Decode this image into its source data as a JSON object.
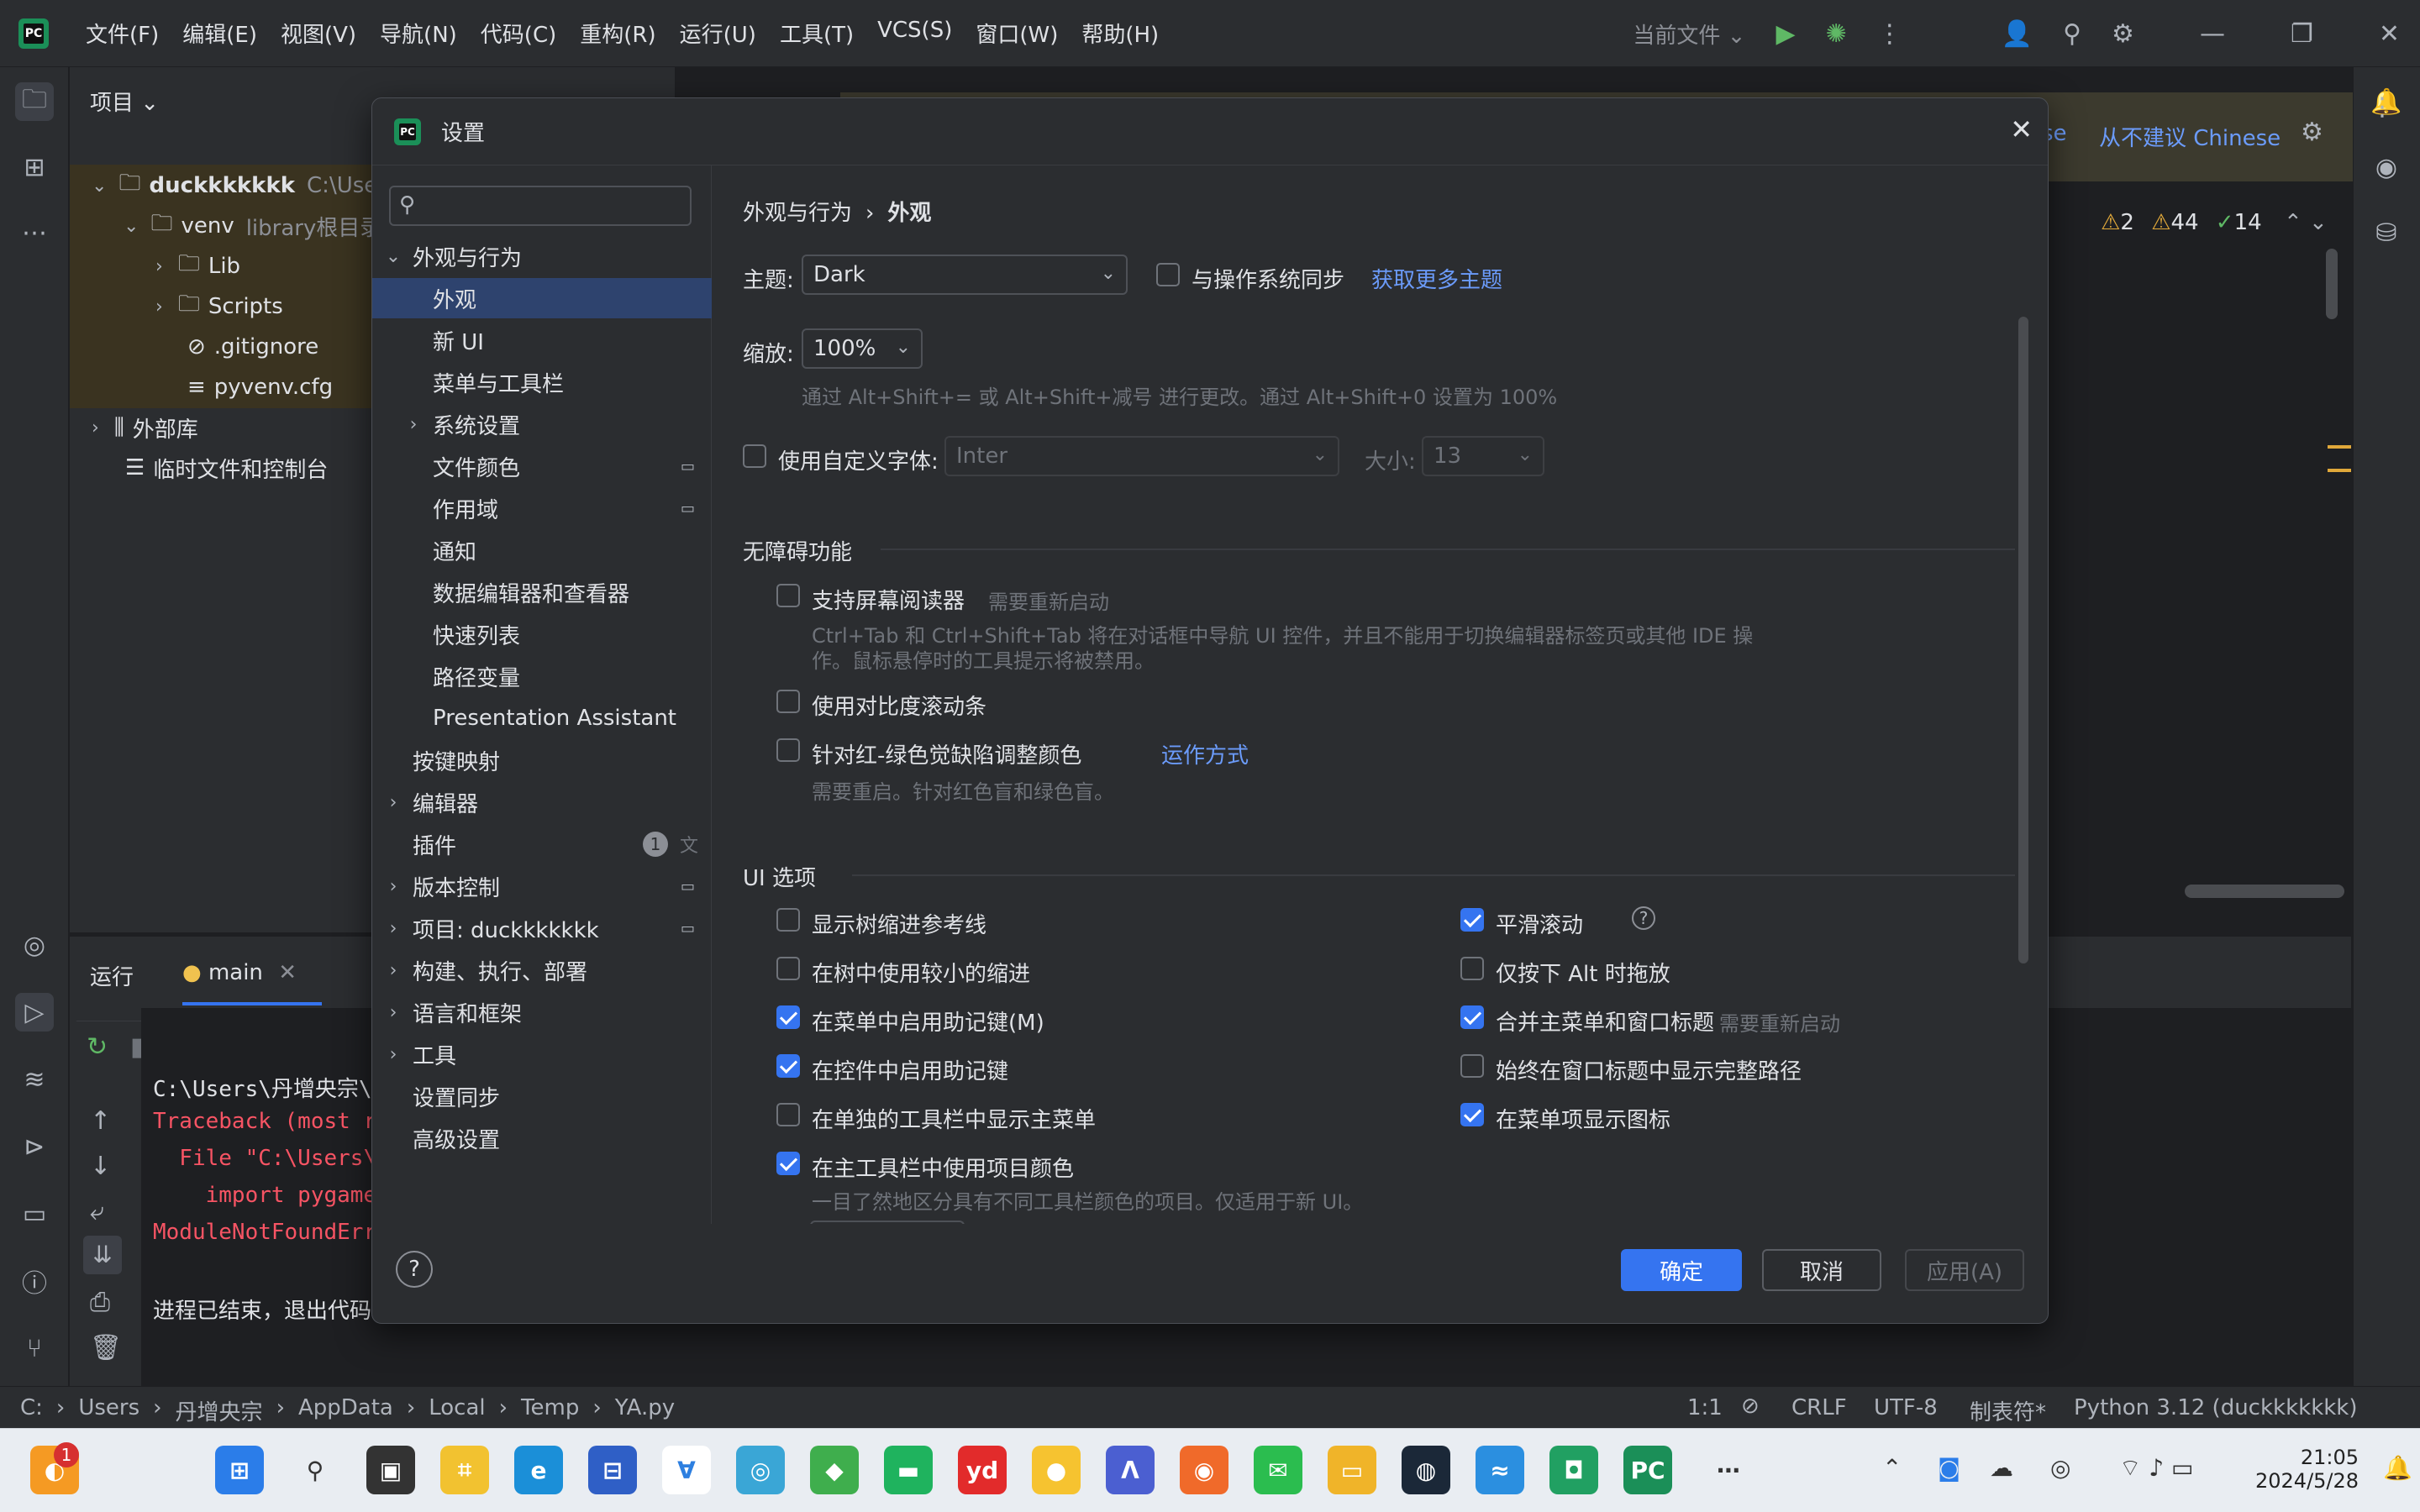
{
  "titlebar": {
    "menus": [
      "文件(F)",
      "编辑(E)",
      "视图(V)",
      "导航(N)",
      "代码(C)",
      "重构(R)",
      "运行(U)",
      "工具(T)",
      "VCS(S)",
      "窗口(W)",
      "帮助(H)"
    ],
    "run_config": "当前文件",
    "logo_text": "PC"
  },
  "project": {
    "title": "项目",
    "rows": [
      {
        "label": "duckkkkkkk",
        "extra": "C:\\Users",
        "bold": true
      },
      {
        "label": "venv",
        "extra": "library根目录"
      },
      {
        "label": "Lib"
      },
      {
        "label": "Scripts"
      },
      {
        "label": ".gitignore"
      },
      {
        "label": "pyvenv.cfg"
      },
      {
        "label": "外部库"
      },
      {
        "label": "临时文件和控制台"
      }
    ]
  },
  "editor": {
    "banner_link": "从不建议 Chinese",
    "banner_partial": "se",
    "inspections": {
      "warn_a": "2",
      "warn_b": "44",
      "ok": "14"
    }
  },
  "run": {
    "tab_label": "运行",
    "tab_name": "main",
    "lines": [
      "C:\\Users\\丹增央宗\\",
      "Traceback (most r",
      "  File \"C:\\Users\\",
      "    import pygame",
      "ModuleNotFoundErr",
      "",
      "进程已结束，退出代码"
    ]
  },
  "status": {
    "path": [
      "C:",
      "Users",
      "丹增央宗",
      "AppData",
      "Local",
      "Temp",
      "YA.py"
    ],
    "position": "1:1",
    "line_sep": "CRLF",
    "encoding": "UTF-8",
    "indent": "制表符*",
    "interpreter": "Python 3.12 (duckkkkkkk)"
  },
  "taskbar": {
    "time": "21:05",
    "date": "2024/5/28",
    "badge": "1"
  },
  "dialog": {
    "title": "设置",
    "search_placeholder": "",
    "nav": [
      {
        "label": "外观与行为",
        "level": 0,
        "chev": "v"
      },
      {
        "label": "外观",
        "level": 1,
        "selected": true
      },
      {
        "label": "新 UI",
        "level": 1
      },
      {
        "label": "菜单与工具栏",
        "level": 1
      },
      {
        "label": "系统设置",
        "level": 1,
        "chev": ">"
      },
      {
        "label": "文件颜色",
        "level": 1,
        "mark": true
      },
      {
        "label": "作用域",
        "level": 1,
        "mark": true
      },
      {
        "label": "通知",
        "level": 1
      },
      {
        "label": "数据编辑器和查看器",
        "level": 1
      },
      {
        "label": "快速列表",
        "level": 1
      },
      {
        "label": "路径变量",
        "level": 1
      },
      {
        "label": "Presentation Assistant",
        "level": 1
      },
      {
        "label": "按键映射",
        "level": 0
      },
      {
        "label": "编辑器",
        "level": 0,
        "chev": ">"
      },
      {
        "label": "插件",
        "level": 0,
        "badge": "1",
        "translate": "文A"
      },
      {
        "label": "版本控制",
        "level": 0,
        "chev": ">",
        "mark": true
      },
      {
        "label": "项目: duckkkkkkk",
        "level": 0,
        "chev": ">",
        "mark": true
      },
      {
        "label": "构建、执行、部署",
        "level": 0,
        "chev": ">"
      },
      {
        "label": "语言和框架",
        "level": 0,
        "chev": ">"
      },
      {
        "label": "工具",
        "level": 0,
        "chev": ">"
      },
      {
        "label": "设置同步",
        "level": 0
      },
      {
        "label": "高级设置",
        "level": 0
      }
    ],
    "breadcrumb": [
      "外观与行为",
      "外观"
    ],
    "theme_label": "主题:",
    "theme_value": "Dark",
    "sync_os": "与操作系统同步",
    "more_themes": "获取更多主题",
    "zoom_label": "缩放:",
    "zoom_value": "100%",
    "zoom_hint": "通过 Alt+Shift+= 或 Alt+Shift+减号 进行更改。通过 Alt+Shift+0 设置为 100%",
    "custom_font": "使用自定义字体:",
    "font_value": "Inter",
    "size_label": "大小:",
    "size_value": "13",
    "a11y_header": "无障碍功能",
    "screen_reader": "支持屏幕阅读器",
    "screen_reader_note": "需要重新启动",
    "screen_reader_hint1": "Ctrl+Tab 和 Ctrl+Shift+Tab 将在对话框中导航 UI 控件，并且不能用于切换编辑器标签页或其他 IDE 操",
    "screen_reader_hint2": "作。鼠标悬停时的工具提示将被禁用。",
    "contrast_scroll": "使用对比度滚动条",
    "colorblind": "针对红-绿色觉缺陷调整颜色",
    "colorblind_link": "运作方式",
    "colorblind_hint": "需要重启。针对红色盲和绿色盲。",
    "ui_header": "UI 选项",
    "left_opts": [
      {
        "label": "显示树缩进参考线",
        "checked": false
      },
      {
        "label": "在树中使用较小的缩进",
        "checked": false
      },
      {
        "label": "在菜单中启用助记键(M)",
        "checked": true
      },
      {
        "label": "在控件中启用助记键",
        "checked": true
      },
      {
        "label": "在单独的工具栏中显示主菜单",
        "checked": false
      },
      {
        "label": "在主工具栏中使用项目颜色",
        "checked": true
      }
    ],
    "project_color_hint": "一目了然地区分具有不同工具栏颜色的项目。仅适用于新 UI。",
    "right_opts": [
      {
        "label": "平滑滚动",
        "checked": true
      },
      {
        "label": "仅按下 Alt 时拖放",
        "checked": false
      },
      {
        "label": "合并主菜单和窗口标题",
        "checked": true,
        "note": "需要重新启动"
      },
      {
        "label": "始终在窗口标题中显示完整路径",
        "checked": false
      },
      {
        "label": "在菜单项显示图标",
        "checked": true
      }
    ],
    "ok": "确定",
    "cancel": "取消",
    "apply": "应用(A)",
    "help": "?"
  },
  "colors": {
    "accent": "#3574f0",
    "selection": "#2e436e",
    "link": "#6b9bfa",
    "bg": "#2b2d30",
    "editor_bg": "#1e1f22"
  }
}
